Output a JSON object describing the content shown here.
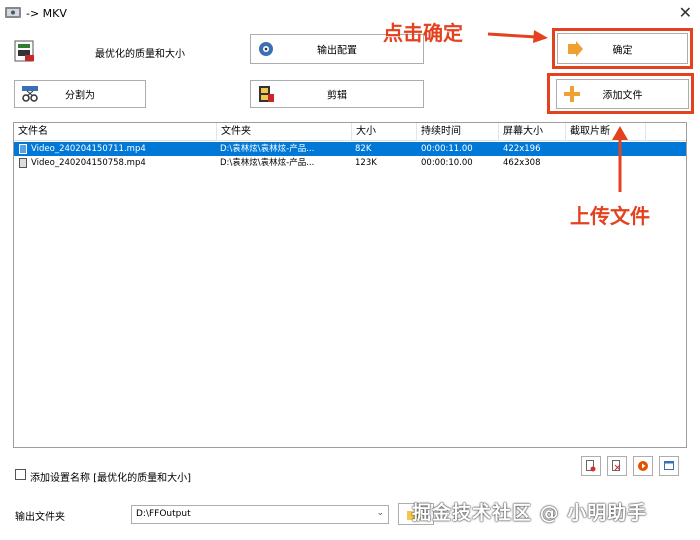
{
  "window": {
    "title": "-> MKV"
  },
  "top": {
    "quality_label": "最优化的质量和大小",
    "output_config_label": "输出配置",
    "ok_label": "确定",
    "split_label": "分割为",
    "edit_label": "剪辑",
    "add_file_label": "添加文件"
  },
  "annotations": {
    "click_ok": "点击确定",
    "upload_file": "上传文件",
    "color": "#e4421f"
  },
  "table": {
    "headers": [
      "文件名",
      "文件夹",
      "大小",
      "持续时间",
      "屏幕大小",
      "截取片断"
    ],
    "rows": [
      {
        "name": "Video_240204150711.mp4",
        "folder": "D:\\袁林炫\\袁林炫-产品...",
        "size": "82K",
        "duration": "00:00:11.00",
        "screen": "422x196",
        "clip": "",
        "selected": true
      },
      {
        "name": "Video_240204150758.mp4",
        "folder": "D:\\袁林炫\\袁林炫-产品...",
        "size": "123K",
        "duration": "00:00:10.00",
        "screen": "462x308",
        "clip": "",
        "selected": false
      }
    ]
  },
  "bottom": {
    "add_setting_name": "添加设置名称  [最优化的质量和大小]",
    "output_folder_label": "输出文件夹",
    "output_folder_value": "D:\\FFOutput"
  },
  "watermark": "掘金技术社区 @ 小明助手"
}
